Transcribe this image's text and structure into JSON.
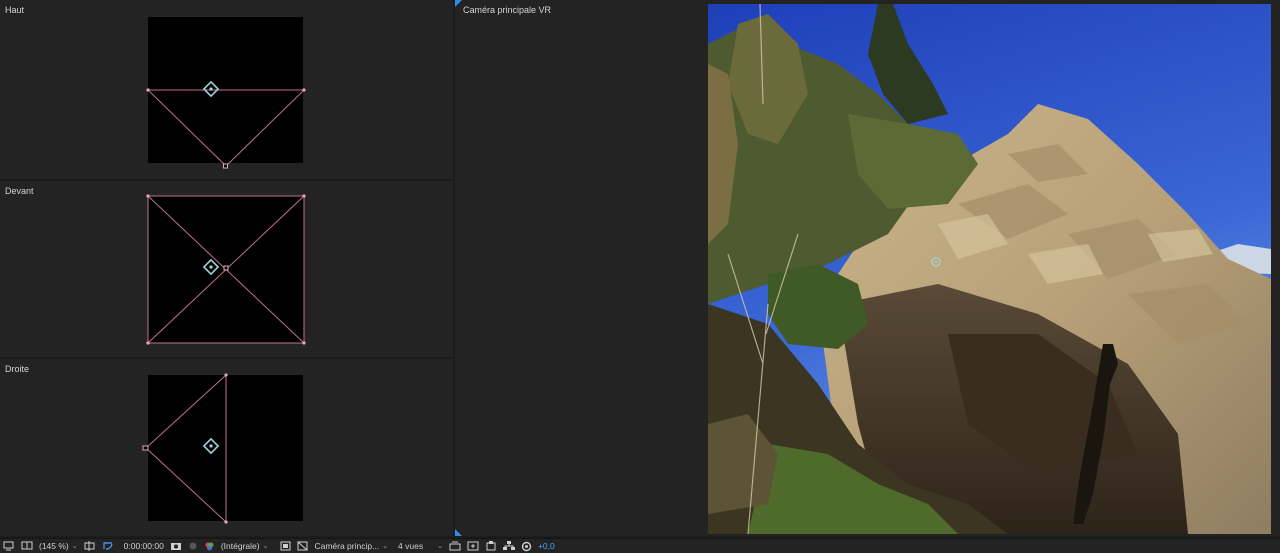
{
  "views": {
    "top": {
      "label": "Haut"
    },
    "front": {
      "label": "Devant"
    },
    "right": {
      "label": "Droite"
    },
    "main": {
      "label": "Caméra principale VR"
    }
  },
  "toolbar": {
    "zoom": "(145 %)",
    "timecode": "0:00:00:00",
    "resolution": "(Intégrale)",
    "camera": "Caméra princip...",
    "view_layout": "4 vues",
    "exposure": "+0,0"
  },
  "colors": {
    "accent": "#2d8ceb",
    "frustum_line": "#c2708a",
    "camera_icon": "#9fd4d8",
    "panel_bg": "#232323"
  },
  "icons": [
    "monitor-icon",
    "grid-icon",
    "mask-icon",
    "camera-snapshot-icon",
    "color-channels-icon",
    "region-icon",
    "transparency-grid-icon",
    "view-select-icon",
    "draft-3d-icon",
    "reset-exposure-icon"
  ]
}
